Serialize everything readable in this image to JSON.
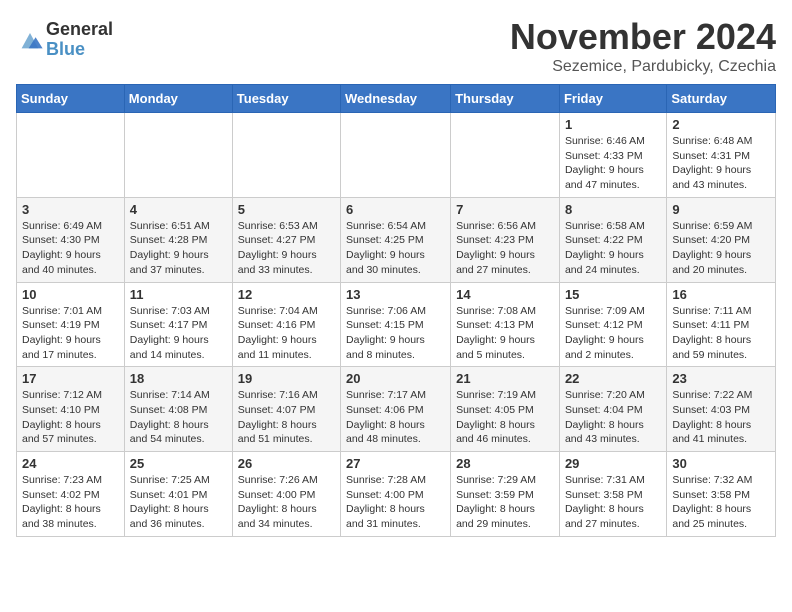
{
  "logo": {
    "general": "General",
    "blue": "Blue"
  },
  "title": "November 2024",
  "location": "Sezemice, Pardubicky, Czechia",
  "days_of_week": [
    "Sunday",
    "Monday",
    "Tuesday",
    "Wednesday",
    "Thursday",
    "Friday",
    "Saturday"
  ],
  "weeks": [
    [
      {
        "day": "",
        "info": ""
      },
      {
        "day": "",
        "info": ""
      },
      {
        "day": "",
        "info": ""
      },
      {
        "day": "",
        "info": ""
      },
      {
        "day": "",
        "info": ""
      },
      {
        "day": "1",
        "info": "Sunrise: 6:46 AM\nSunset: 4:33 PM\nDaylight: 9 hours and 47 minutes."
      },
      {
        "day": "2",
        "info": "Sunrise: 6:48 AM\nSunset: 4:31 PM\nDaylight: 9 hours and 43 minutes."
      }
    ],
    [
      {
        "day": "3",
        "info": "Sunrise: 6:49 AM\nSunset: 4:30 PM\nDaylight: 9 hours and 40 minutes."
      },
      {
        "day": "4",
        "info": "Sunrise: 6:51 AM\nSunset: 4:28 PM\nDaylight: 9 hours and 37 minutes."
      },
      {
        "day": "5",
        "info": "Sunrise: 6:53 AM\nSunset: 4:27 PM\nDaylight: 9 hours and 33 minutes."
      },
      {
        "day": "6",
        "info": "Sunrise: 6:54 AM\nSunset: 4:25 PM\nDaylight: 9 hours and 30 minutes."
      },
      {
        "day": "7",
        "info": "Sunrise: 6:56 AM\nSunset: 4:23 PM\nDaylight: 9 hours and 27 minutes."
      },
      {
        "day": "8",
        "info": "Sunrise: 6:58 AM\nSunset: 4:22 PM\nDaylight: 9 hours and 24 minutes."
      },
      {
        "day": "9",
        "info": "Sunrise: 6:59 AM\nSunset: 4:20 PM\nDaylight: 9 hours and 20 minutes."
      }
    ],
    [
      {
        "day": "10",
        "info": "Sunrise: 7:01 AM\nSunset: 4:19 PM\nDaylight: 9 hours and 17 minutes."
      },
      {
        "day": "11",
        "info": "Sunrise: 7:03 AM\nSunset: 4:17 PM\nDaylight: 9 hours and 14 minutes."
      },
      {
        "day": "12",
        "info": "Sunrise: 7:04 AM\nSunset: 4:16 PM\nDaylight: 9 hours and 11 minutes."
      },
      {
        "day": "13",
        "info": "Sunrise: 7:06 AM\nSunset: 4:15 PM\nDaylight: 9 hours and 8 minutes."
      },
      {
        "day": "14",
        "info": "Sunrise: 7:08 AM\nSunset: 4:13 PM\nDaylight: 9 hours and 5 minutes."
      },
      {
        "day": "15",
        "info": "Sunrise: 7:09 AM\nSunset: 4:12 PM\nDaylight: 9 hours and 2 minutes."
      },
      {
        "day": "16",
        "info": "Sunrise: 7:11 AM\nSunset: 4:11 PM\nDaylight: 8 hours and 59 minutes."
      }
    ],
    [
      {
        "day": "17",
        "info": "Sunrise: 7:12 AM\nSunset: 4:10 PM\nDaylight: 8 hours and 57 minutes."
      },
      {
        "day": "18",
        "info": "Sunrise: 7:14 AM\nSunset: 4:08 PM\nDaylight: 8 hours and 54 minutes."
      },
      {
        "day": "19",
        "info": "Sunrise: 7:16 AM\nSunset: 4:07 PM\nDaylight: 8 hours and 51 minutes."
      },
      {
        "day": "20",
        "info": "Sunrise: 7:17 AM\nSunset: 4:06 PM\nDaylight: 8 hours and 48 minutes."
      },
      {
        "day": "21",
        "info": "Sunrise: 7:19 AM\nSunset: 4:05 PM\nDaylight: 8 hours and 46 minutes."
      },
      {
        "day": "22",
        "info": "Sunrise: 7:20 AM\nSunset: 4:04 PM\nDaylight: 8 hours and 43 minutes."
      },
      {
        "day": "23",
        "info": "Sunrise: 7:22 AM\nSunset: 4:03 PM\nDaylight: 8 hours and 41 minutes."
      }
    ],
    [
      {
        "day": "24",
        "info": "Sunrise: 7:23 AM\nSunset: 4:02 PM\nDaylight: 8 hours and 38 minutes."
      },
      {
        "day": "25",
        "info": "Sunrise: 7:25 AM\nSunset: 4:01 PM\nDaylight: 8 hours and 36 minutes."
      },
      {
        "day": "26",
        "info": "Sunrise: 7:26 AM\nSunset: 4:00 PM\nDaylight: 8 hours and 34 minutes."
      },
      {
        "day": "27",
        "info": "Sunrise: 7:28 AM\nSunset: 4:00 PM\nDaylight: 8 hours and 31 minutes."
      },
      {
        "day": "28",
        "info": "Sunrise: 7:29 AM\nSunset: 3:59 PM\nDaylight: 8 hours and 29 minutes."
      },
      {
        "day": "29",
        "info": "Sunrise: 7:31 AM\nSunset: 3:58 PM\nDaylight: 8 hours and 27 minutes."
      },
      {
        "day": "30",
        "info": "Sunrise: 7:32 AM\nSunset: 3:58 PM\nDaylight: 8 hours and 25 minutes."
      }
    ]
  ]
}
